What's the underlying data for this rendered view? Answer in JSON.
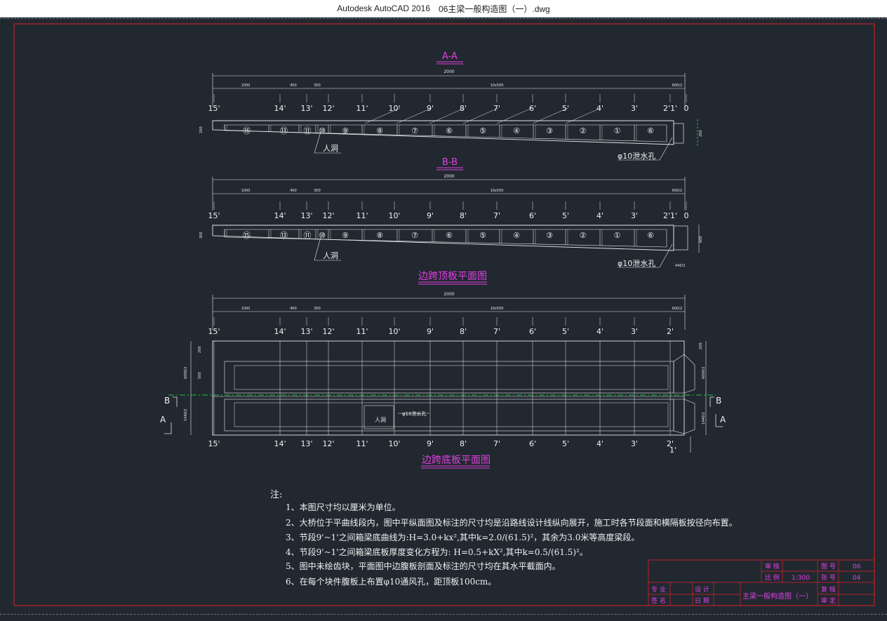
{
  "window": {
    "app_title": "Autodesk AutoCAD 2016",
    "file_name": "06主梁一般构造图（一）.dwg"
  },
  "colors": {
    "background": "#212830",
    "frame": "#e0202a",
    "heading": "#e040e0",
    "lines": "#e8e8e8",
    "centerline": "#20c040"
  },
  "sections": {
    "aa_title": "A-A",
    "bb_title": "B-B",
    "top_plan_title": "边跨顶板平面图",
    "bottom_plan_title": "边跨底板平面图"
  },
  "dimensions": {
    "total": "2000",
    "seg1": "1000",
    "seg2": "400",
    "seg3": "300",
    "middle": "10x500",
    "end": "600/2",
    "height_left": "200",
    "height_right": "300",
    "bb_right_h": "600",
    "bb_bottom": "440/2",
    "plan_side1": "6000/2",
    "plan_side2": "1440/2",
    "plan_sm1": "200",
    "plan_sm2": "500"
  },
  "segment_labels": [
    "15'",
    "14'",
    "13'",
    "12'",
    "11'",
    "10'",
    "9'",
    "8'",
    "7'",
    "6'",
    "5'",
    "4'",
    "3'",
    "2'1'",
    "0"
  ],
  "plan_labels": [
    "15'",
    "14'",
    "13'",
    "12'",
    "11'",
    "10'",
    "9'",
    "8'",
    "7'",
    "6'",
    "5'",
    "4'",
    "3'",
    "2'"
  ],
  "bottom_extra_label": "1'",
  "circled_numbers": [
    "⑮",
    "⑬",
    "⑪",
    "⑩",
    "⑨",
    "⑧",
    "⑦",
    "⑥",
    "⑤",
    "④",
    "③",
    "②",
    "①",
    "⑥"
  ],
  "callouts": {
    "manhole": "人洞",
    "drain_hole": "φ10泄水孔",
    "manhole_small": "人洞",
    "drain_small": "φ10泄水孔"
  },
  "section_marks": {
    "b": "B",
    "a": "A"
  },
  "notes": {
    "heading": "注:",
    "items": [
      "1、本图尺寸均以厘米为单位。",
      "2、大桥位于平曲线段内，图中平纵面图及标注的尺寸均是沿路线设计线纵向展开，施工时各节段面和横隔板按径向布置。",
      "3、节段9'~1'之间箱梁底曲线为:H=3.0+kx²,其中k=2.0/(61.5)²，其余为3.0米等高度梁段。",
      "4、节段9'~1'之间箱梁底板厚度变化方程为: H=0.5+kX²,其中k=0.5/(61.5)²。",
      "5、图中未绘齿块，平面图中边腹板剖面及标注的尺寸均在其水平截面内。",
      "6、在每个块件腹板上布置φ10通风孔，距顶板100cm。"
    ]
  },
  "title_block": {
    "drawing_title": "主梁一般构造图（一）",
    "label_review": "审 核",
    "label_scale": "比 例",
    "scale_value": "1:300",
    "label_drawing_no": "图 号",
    "drawing_no_value": "06",
    "label_sheet": "张 号",
    "sheet_value": "04",
    "label_major": "专 业",
    "label_design": "设 计",
    "label_check": "复 核",
    "label_name": "签 名",
    "label_date": "日 期",
    "label_approve": "审 定"
  }
}
